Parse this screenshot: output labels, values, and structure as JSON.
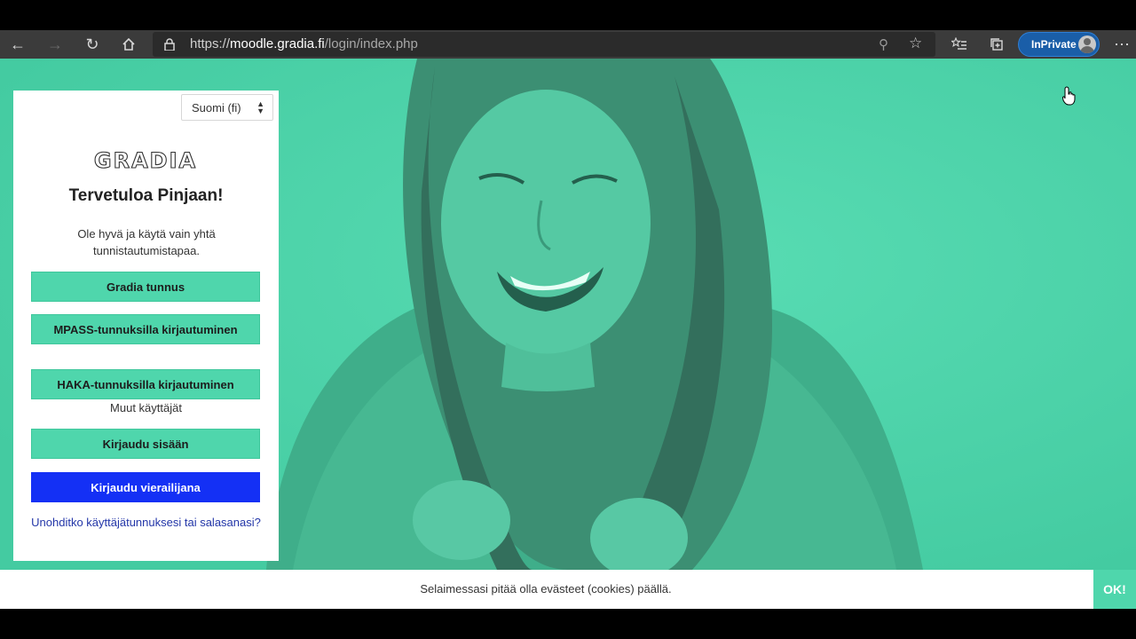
{
  "browser": {
    "url_scheme": "https://",
    "url_host": "moodle.gradia.fi",
    "url_path": "/login/index.php",
    "inprivate_label": "InPrivate",
    "icons": [
      "back-icon",
      "forward-icon",
      "refresh-icon",
      "home-icon",
      "lock-icon",
      "zoom-icon",
      "favorite-star-icon",
      "favorites-list-icon",
      "collections-icon",
      "profile-avatar-icon",
      "more-icon"
    ]
  },
  "login": {
    "language": "Suomi (fi)",
    "logo_text": "GRADIA",
    "welcome": "Tervetuloa Pinjaan!",
    "intro": "Ole hyvä ja käytä vain yhtä tunnistautumistapaa.",
    "buttons": [
      {
        "label": "Gradia tunnus"
      },
      {
        "label": "MPASS-tunnuksilla kirjautuminen"
      },
      {
        "label": "HAKA-tunnuksilla kirjautuminen"
      }
    ],
    "other_users": "Muut käyttäjät",
    "login_button": "Kirjaudu sisään",
    "guest_button": "Kirjaudu vierailijana",
    "forgot_link": "Unohditko käyttäjätunnuksesi tai salasanasi?"
  },
  "cookie": {
    "message": "Selaimessasi pitää olla evästeet (cookies) päällä.",
    "ok_label": "OK!"
  },
  "colors": {
    "accent": "#4fd6ac",
    "guest_button": "#1430f5",
    "link": "#2336a8"
  }
}
